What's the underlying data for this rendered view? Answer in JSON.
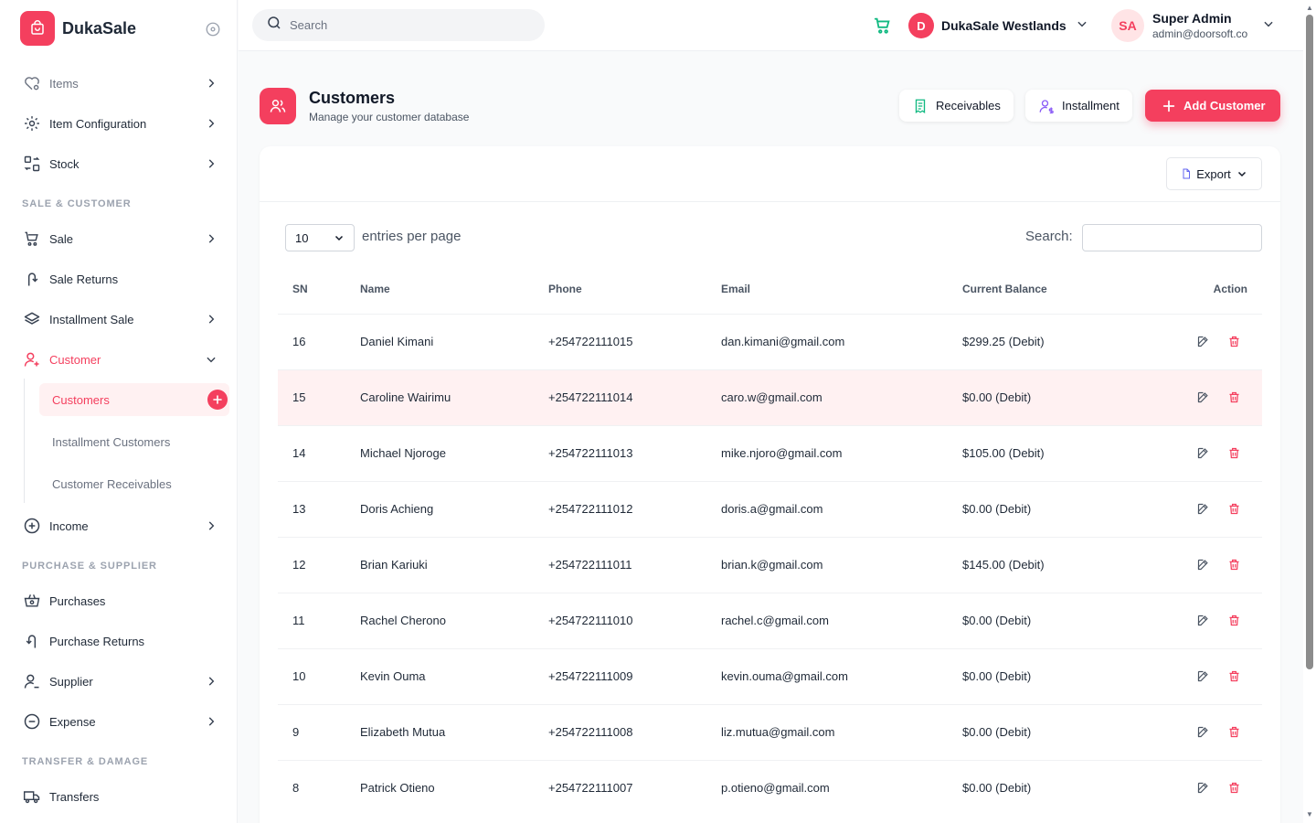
{
  "brand": {
    "name": "DukaSale"
  },
  "colors": {
    "accent": "#f43f5e",
    "success": "#10b981",
    "violet": "#8b5cf6"
  },
  "sidebar": {
    "items": [
      {
        "label": "Items",
        "icon": "tag-heart-icon",
        "chevron": "right"
      },
      {
        "label": "Item Configuration",
        "icon": "gear-cog-icon",
        "chevron": "right"
      },
      {
        "label": "Stock",
        "icon": "stock-transfer-icon",
        "chevron": "right"
      }
    ],
    "sections": {
      "sale": "SALE & CUSTOMER",
      "purchase": "PURCHASE & SUPPLIER",
      "transfer": "TRANSFER & DAMAGE"
    },
    "sale_items": [
      {
        "label": "Sale",
        "icon": "cart-sale-icon",
        "chevron": "right"
      },
      {
        "label": "Sale Returns",
        "icon": "return-arrow-icon"
      },
      {
        "label": "Installment Sale",
        "icon": "layers-icon",
        "chevron": "right"
      },
      {
        "label": "Customer",
        "icon": "user-plus-icon",
        "chevron": "down"
      }
    ],
    "customer_sub": [
      {
        "label": "Customers",
        "active": true
      },
      {
        "label": "Installment Customers"
      },
      {
        "label": "Customer Receivables"
      }
    ],
    "income": {
      "label": "Income",
      "icon": "plus-circle-icon"
    },
    "purchase_items": [
      {
        "label": "Purchases",
        "icon": "basket-icon"
      },
      {
        "label": "Purchase Returns",
        "icon": "return-arrow-icon"
      },
      {
        "label": "Supplier",
        "icon": "user-minus-icon",
        "chevron": "right"
      },
      {
        "label": "Expense",
        "icon": "minus-circle-icon",
        "chevron": "right"
      }
    ],
    "transfer_items": [
      {
        "label": "Transfers",
        "icon": "truck-icon"
      }
    ]
  },
  "header": {
    "search_placeholder": "Search",
    "store": {
      "initial": "D",
      "name": "DukaSale Westlands"
    },
    "user": {
      "initials": "SA",
      "name": "Super Admin",
      "email": "admin@doorsoft.co"
    }
  },
  "page": {
    "title": "Customers",
    "subtitle": "Manage your customer database",
    "buttons": {
      "receivables": "Receivables",
      "installment": "Installment",
      "add": "Add Customer"
    }
  },
  "table": {
    "export_label": "Export",
    "entries_value": "10",
    "entries_label": "entries per page",
    "search_label": "Search:",
    "columns": [
      "SN",
      "Name",
      "Phone",
      "Email",
      "Current Balance",
      "Action"
    ],
    "rows": [
      {
        "sn": "16",
        "name": "Daniel Kimani",
        "phone": "+254722111015",
        "email": "dan.kimani@gmail.com",
        "balance": "$299.25 (Debit)"
      },
      {
        "sn": "15",
        "name": "Caroline Wairimu",
        "phone": "+254722111014",
        "email": "caro.w@gmail.com",
        "balance": "$0.00 (Debit)"
      },
      {
        "sn": "14",
        "name": "Michael Njoroge",
        "phone": "+254722111013",
        "email": "mike.njoro@gmail.com",
        "balance": "$105.00 (Debit)"
      },
      {
        "sn": "13",
        "name": "Doris Achieng",
        "phone": "+254722111012",
        "email": "doris.a@gmail.com",
        "balance": "$0.00 (Debit)"
      },
      {
        "sn": "12",
        "name": "Brian Kariuki",
        "phone": "+254722111011",
        "email": "brian.k@gmail.com",
        "balance": "$145.00 (Debit)"
      },
      {
        "sn": "11",
        "name": "Rachel Cherono",
        "phone": "+254722111010",
        "email": "rachel.c@gmail.com",
        "balance": "$0.00 (Debit)"
      },
      {
        "sn": "10",
        "name": "Kevin Ouma",
        "phone": "+254722111009",
        "email": "kevin.ouma@gmail.com",
        "balance": "$0.00 (Debit)"
      },
      {
        "sn": "9",
        "name": "Elizabeth Mutua",
        "phone": "+254722111008",
        "email": "liz.mutua@gmail.com",
        "balance": "$0.00 (Debit)"
      },
      {
        "sn": "8",
        "name": "Patrick Otieno",
        "phone": "+254722111007",
        "email": "p.otieno@gmail.com",
        "balance": "$0.00 (Debit)"
      }
    ]
  }
}
